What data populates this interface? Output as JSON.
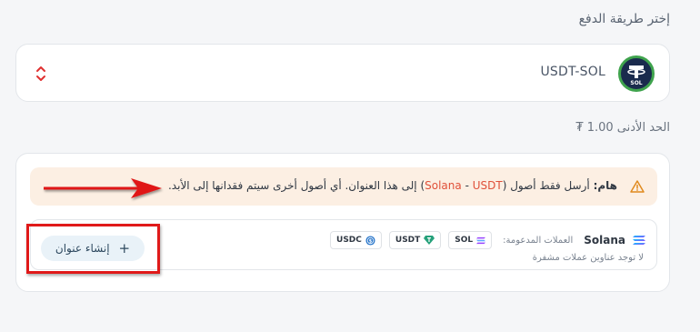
{
  "section_title": "إختر طريقة الدفع",
  "payment_select": {
    "selected_value": "USDT-SOL",
    "coin_logo_text": "SOL",
    "logo_icon": "tether-icon",
    "chevron_icon": "chevron-updown-icon"
  },
  "minimum": {
    "label": "الحد الأدنى 1.00 ₮"
  },
  "warning": {
    "icon": "warning-triangle-icon",
    "strong": "هام:",
    "part1": "أرسل فقط أصول (",
    "network": "Solana",
    "dash": " - ",
    "coin": "USDT",
    "part2": ") إلى هذا العنوان. أي أصول أخرى سيتم فقدانها إلى الأبد."
  },
  "network": {
    "name": "Solana",
    "supported_label": "العملات المدعومة:",
    "coins": [
      {
        "name": "SOL",
        "icon": "solana-icon"
      },
      {
        "name": "USDT",
        "icon": "tether-gem-icon"
      },
      {
        "name": "USDC",
        "icon": "usdc-icon"
      }
    ],
    "no_addresses": "لا توجد عناوين عملات مشفرة",
    "create_button": "إنشاء عنوان"
  },
  "colors": {
    "annotation_red": "#e01919",
    "warning_bg": "#fcefe3",
    "highlight": "#e0513a"
  }
}
